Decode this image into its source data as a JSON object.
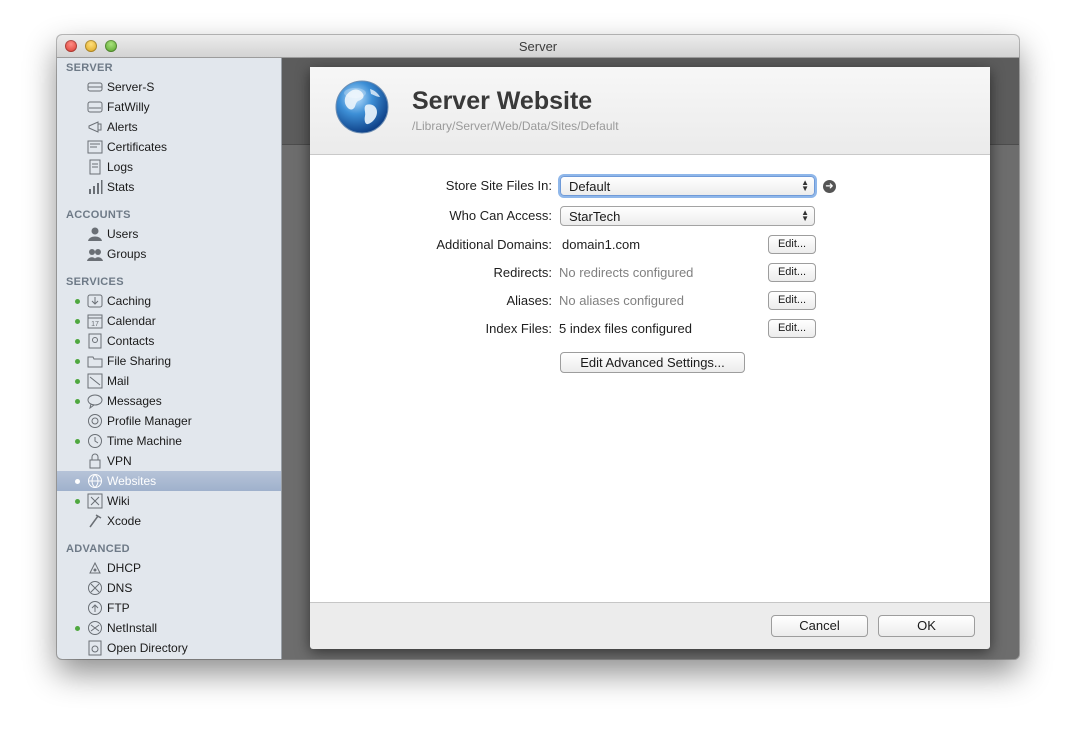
{
  "window": {
    "title": "Server"
  },
  "sidebar": {
    "sections": [
      {
        "heading": "SERVER",
        "items": [
          {
            "label": "Server-S",
            "icon": "server-icon",
            "status": false
          },
          {
            "label": "FatWilly",
            "icon": "drive-icon",
            "status": false
          },
          {
            "label": "Alerts",
            "icon": "megaphone-icon",
            "status": false
          },
          {
            "label": "Certificates",
            "icon": "certificate-icon",
            "status": false
          },
          {
            "label": "Logs",
            "icon": "log-icon",
            "status": false
          },
          {
            "label": "Stats",
            "icon": "stats-icon",
            "status": false
          }
        ]
      },
      {
        "heading": "ACCOUNTS",
        "items": [
          {
            "label": "Users",
            "icon": "user-icon",
            "status": false
          },
          {
            "label": "Groups",
            "icon": "group-icon",
            "status": false
          }
        ]
      },
      {
        "heading": "SERVICES",
        "items": [
          {
            "label": "Caching",
            "icon": "caching-icon",
            "status": true
          },
          {
            "label": "Calendar",
            "icon": "calendar-icon",
            "status": true
          },
          {
            "label": "Contacts",
            "icon": "contacts-icon",
            "status": true
          },
          {
            "label": "File Sharing",
            "icon": "file-sharing-icon",
            "status": true
          },
          {
            "label": "Mail",
            "icon": "mail-icon",
            "status": true
          },
          {
            "label": "Messages",
            "icon": "messages-icon",
            "status": true
          },
          {
            "label": "Profile Manager",
            "icon": "profile-manager-icon",
            "status": false
          },
          {
            "label": "Time Machine",
            "icon": "time-machine-icon",
            "status": true
          },
          {
            "label": "VPN",
            "icon": "vpn-icon",
            "status": false
          },
          {
            "label": "Websites",
            "icon": "websites-icon",
            "status": true,
            "selected": true
          },
          {
            "label": "Wiki",
            "icon": "wiki-icon",
            "status": true
          },
          {
            "label": "Xcode",
            "icon": "xcode-icon",
            "status": false
          }
        ]
      },
      {
        "heading": "ADVANCED",
        "items": [
          {
            "label": "DHCP",
            "icon": "dhcp-icon",
            "status": false
          },
          {
            "label": "DNS",
            "icon": "dns-icon",
            "status": false
          },
          {
            "label": "FTP",
            "icon": "ftp-icon",
            "status": false
          },
          {
            "label": "NetInstall",
            "icon": "netinstall-icon",
            "status": true
          },
          {
            "label": "Open Directory",
            "icon": "open-directory-icon",
            "status": false
          }
        ]
      }
    ]
  },
  "sheet": {
    "title": "Server Website",
    "path": "/Library/Server/Web/Data/Sites/Default",
    "icon": "globe-icon",
    "fields": {
      "store": {
        "label": "Store Site Files In:",
        "value": "Default"
      },
      "access": {
        "label": "Who Can Access:",
        "value": "StarTech"
      },
      "domains": {
        "label": "Additional Domains:",
        "value": "domain1.com",
        "button": "Edit..."
      },
      "redirects": {
        "label": "Redirects:",
        "value": "No redirects configured",
        "button": "Edit..."
      },
      "aliases": {
        "label": "Aliases:",
        "value": "No aliases configured",
        "button": "Edit..."
      },
      "index": {
        "label": "Index Files:",
        "value": "5 index files configured",
        "button": "Edit..."
      }
    },
    "advanced_button": "Edit Advanced Settings...",
    "cancel_button": "Cancel",
    "ok_button": "OK"
  },
  "colors": {
    "status_dot": "#4fa83f",
    "selection": "#9fb1cc",
    "focus_ring": "#8fb7ea"
  }
}
